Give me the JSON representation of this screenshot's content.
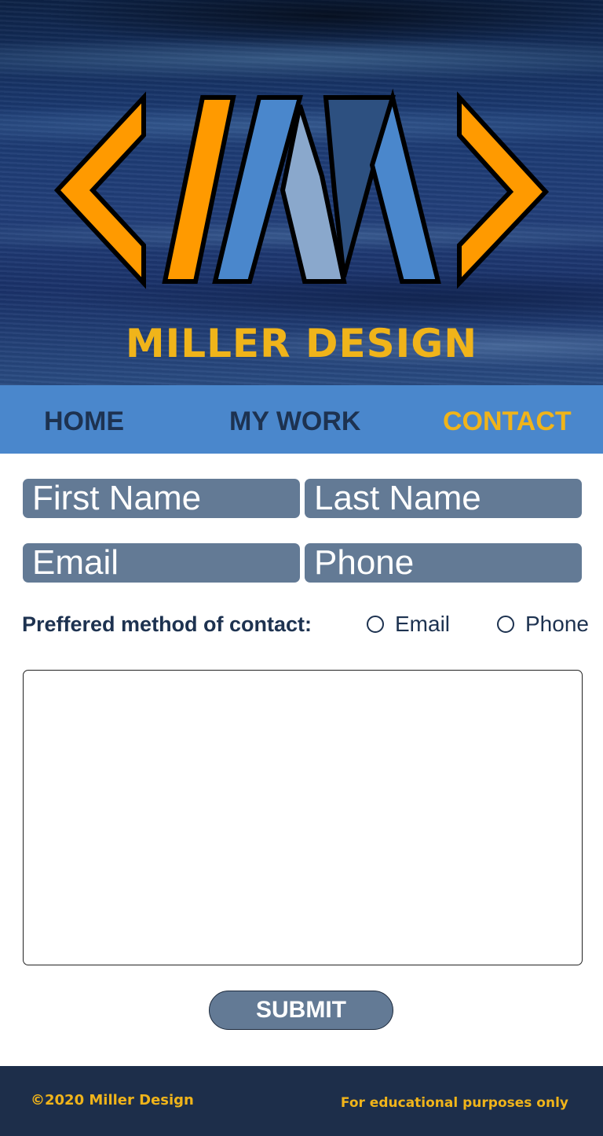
{
  "brand": {
    "name": "MILLER DESIGN",
    "logo_icon": "md-brackets-logo",
    "colors": {
      "orange": "#ff9a00",
      "light_blue": "#4a87cc",
      "pale_blue": "#8aa8cc",
      "dark_blue": "#2d5080",
      "gold": "#f0b41a"
    }
  },
  "nav": {
    "items": [
      {
        "label": "HOME"
      },
      {
        "label": "MY WORK"
      },
      {
        "label": "CONTACT"
      }
    ],
    "active": "CONTACT"
  },
  "form": {
    "first_name_placeholder": "First Name",
    "last_name_placeholder": "Last Name",
    "email_placeholder": "Email",
    "phone_placeholder": "Phone",
    "preference_label": "Preffered method of contact:",
    "preference_options": [
      {
        "label": "Email"
      },
      {
        "label": "Phone"
      }
    ],
    "message_value": "",
    "submit_label": "SUBMIT"
  },
  "footer": {
    "copyright": "©2020 Miller Design",
    "note": "For educational purposes only"
  }
}
